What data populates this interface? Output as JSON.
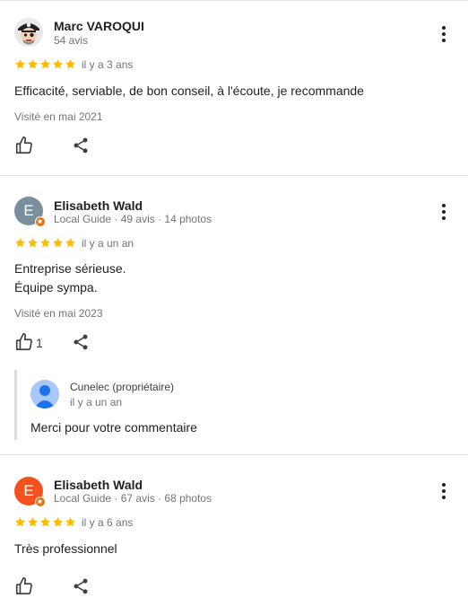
{
  "reviews": [
    {
      "name": "Marc VAROQUI",
      "meta": "54 avis",
      "rating": 5,
      "ago": "il y a 3 ans",
      "text": "Efficacité, serviable, de bon conseil, à l'écoute, je recommande",
      "visited": "Visité en mai 2021",
      "avatar_type": "pirate-cartoon-avatar"
    },
    {
      "name": "Elisabeth Wald",
      "meta": "Local Guide · 49 avis · 14 photos",
      "rating": 5,
      "ago": "il y a un an",
      "text": "Entreprise sérieuse.\nÉquipe sympa.",
      "visited": "Visité en mai 2023",
      "avatar_letter": "E",
      "avatar_color": "#78909c",
      "likes": "1",
      "reply": {
        "name": "Cunelec (propriétaire)",
        "time": "il y a un an",
        "text": "Merci pour votre commentaire"
      }
    },
    {
      "name": "Elisabeth Wald",
      "meta": "Local Guide · 67 avis · 68 photos",
      "rating": 5,
      "ago": "il y a 6 ans",
      "text": "Très professionnel",
      "avatar_letter": "E",
      "avatar_color": "#f4511e"
    }
  ],
  "colors": {
    "star": "#fbbc04",
    "local_guide_badge": "#e8710a",
    "divider": "#e0e0e0",
    "reply_bar": "#dadce0"
  },
  "icons": [
    "more-vert-icon",
    "star-icon",
    "thumb-up-icon",
    "share-icon",
    "local-guide-badge-icon"
  ]
}
